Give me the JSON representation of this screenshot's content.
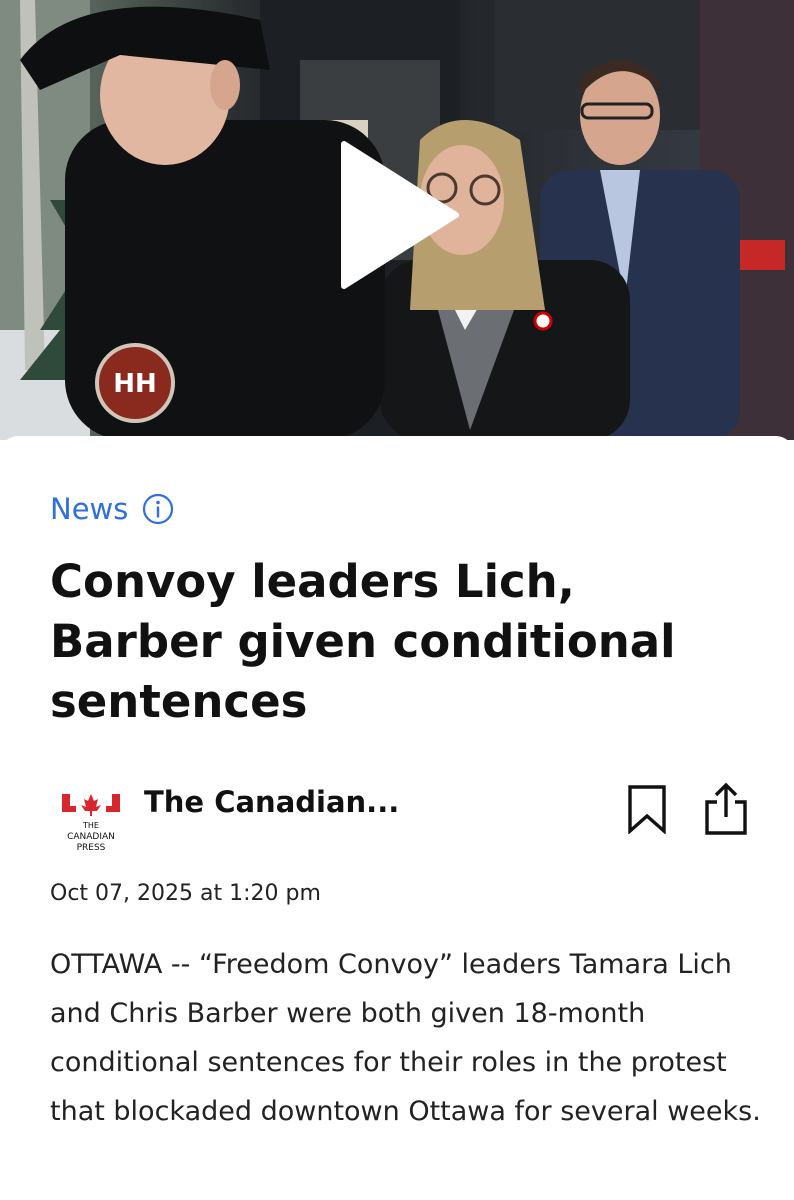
{
  "video": {
    "play_icon": "play-icon",
    "badge_text": "HH"
  },
  "article": {
    "category": "News",
    "info_icon": "info-icon",
    "headline": "Convoy leaders Lich, Barber given conditional sentences",
    "source": {
      "logo_text_line1": "THE",
      "logo_text_line2": "CANADIAN",
      "logo_text_line3": "PRESS",
      "name": "The Canadian..."
    },
    "actions": {
      "bookmark_icon": "bookmark-icon",
      "share_icon": "share-icon"
    },
    "timestamp": "Oct 07, 2025 at 1:20 pm",
    "body": "OTTAWA -- “Freedom Convoy” leaders Tamara Lich and Chris Barber were both given 18-month conditional sentences for their roles in the protest that blockaded downtown Ottawa for several weeks."
  },
  "colors": {
    "accent": "#2f6fe0",
    "logo_red": "#d7262e",
    "text": "#111111"
  }
}
